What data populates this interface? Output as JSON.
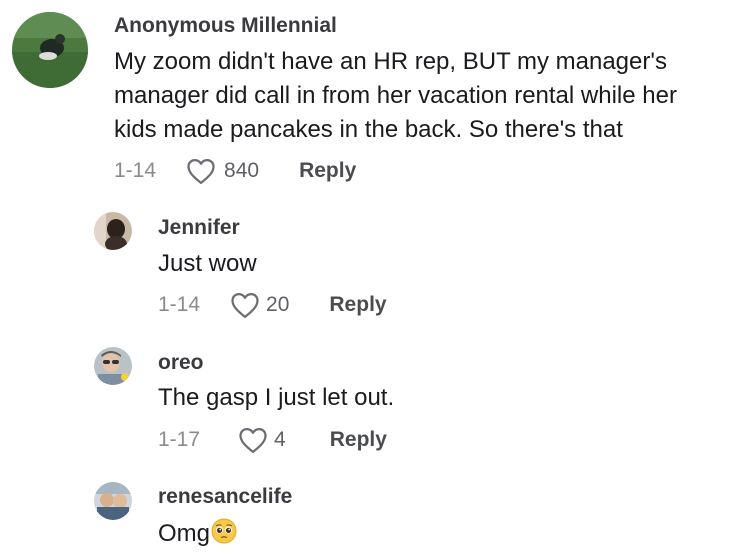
{
  "comments": [
    {
      "username": "Anonymous Millennial",
      "text_lines": [
        "My zoom didn't have an HR rep, BUT my manager's",
        "manager did call in from her vacation rental while her",
        "kids made pancakes in the back. So there's that"
      ],
      "date": "1-14",
      "likes": "840",
      "reply_label": "Reply"
    }
  ],
  "replies": [
    {
      "username": "Jennifer",
      "text": "Just wow",
      "date": "1-14",
      "likes": "20",
      "reply_label": "Reply"
    },
    {
      "username": "oreo",
      "text": "The gasp I just let out.",
      "date": "1-17",
      "likes": "4",
      "reply_label": "Reply"
    },
    {
      "username": "renesancelife",
      "text": "Omg",
      "emoji": "pleading-face-emoji"
    }
  ],
  "icons": {
    "like": "heart-outline-icon"
  },
  "colors": {
    "username": "#3a3a3f",
    "meta": "#8a8b91",
    "text": "#1a1a1f"
  }
}
